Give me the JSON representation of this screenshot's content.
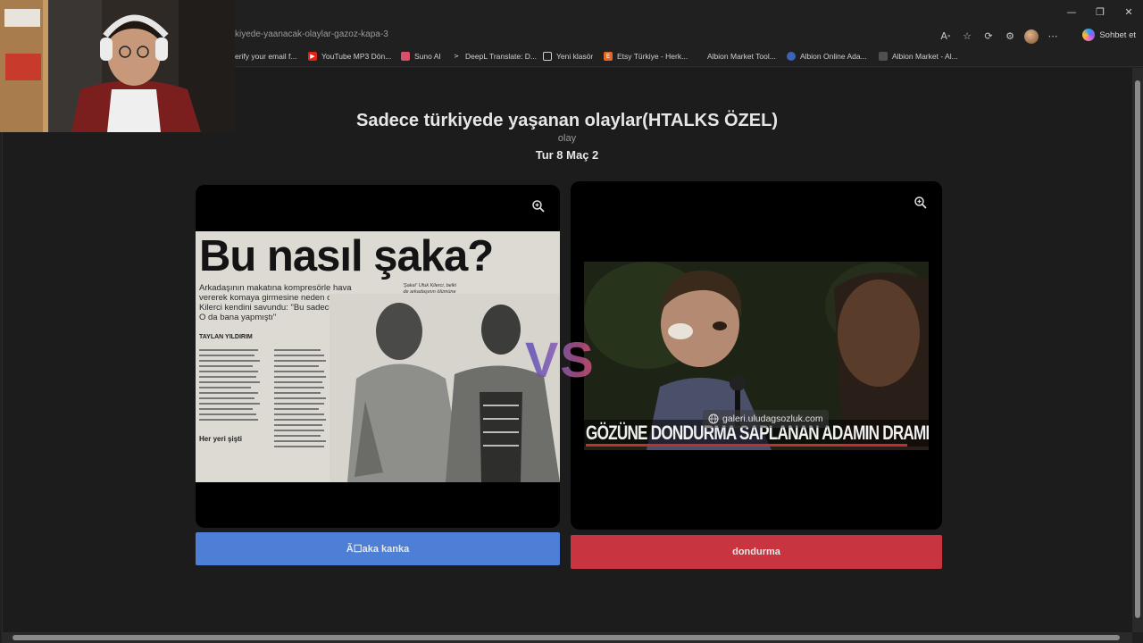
{
  "browser": {
    "url": "kiyede-yaanacak-olaylar-gazoz-kapa-3",
    "copilot_label": "Sohbet et",
    "window_buttons": [
      "—",
      "❐",
      "✕"
    ],
    "toolbar_icons": [
      "read-aloud-icon",
      "favorite-star-icon",
      "extensions-icon",
      "browser-extension-icon",
      "profile-avatar-icon",
      "more-options-icon"
    ],
    "bookmarks": [
      {
        "label": "erify your email f...",
        "icon": "mail-icon",
        "color": "#2b2b2b"
      },
      {
        "label": "YouTube MP3 Dön...",
        "icon": "youtube-icon",
        "color": "#e62117"
      },
      {
        "label": "Suno AI",
        "icon": "suno-icon",
        "color": "#d94f6a"
      },
      {
        "label": "DeepL Translate: D...",
        "icon": "deepl-icon",
        "color": "#1e2a3a"
      },
      {
        "label": "Yeni klasör",
        "icon": "folder-icon",
        "color": "#202020"
      },
      {
        "label": "Etsy Türkiye - Herk...",
        "icon": "etsy-icon",
        "color": "#e8661f"
      },
      {
        "label": "Albion Market Tool...",
        "icon": "albion-icon",
        "color": "#202020"
      },
      {
        "label": "Albion Online Ada...",
        "icon": "shield-icon",
        "color": "#3a64b8"
      },
      {
        "label": "Albion Market - Al...",
        "icon": "albion-market-icon",
        "color": "#505050"
      }
    ]
  },
  "page": {
    "title": "Sadece türkiyede yaşanan olaylar(HTALKS ÖZEL)",
    "category": "olay",
    "round": "Tur 8 Maç 2",
    "vs_text": "VS"
  },
  "left_choice": {
    "button_label": "Ã☐aka kanka",
    "button_color": "#4e7fd6",
    "image": {
      "headline": "Bu nasıl şaka?",
      "lead": "Arkadaşının makatına kompresörle hava vererek komaya girmesine neden olan Ufuk Kilerci kendini savundu: \"Bu sadece şakaydı. O da bana yapmıştı\"",
      "author": "TAYLAN YILDIRIM",
      "caption": "'Şaka!' Ufuk Kilerci, belki de arkadaşının ölümüne neden olacak.",
      "subhead": "Her yeri şişti"
    }
  },
  "right_choice": {
    "button_label": "dondurma",
    "button_color": "#c8343f",
    "image": {
      "caption_text": "GÖZÜNE DONDURMA SAPLANAN ADAMIN DRAMI",
      "watermark": "galeri.uludagsozluk.com"
    }
  }
}
